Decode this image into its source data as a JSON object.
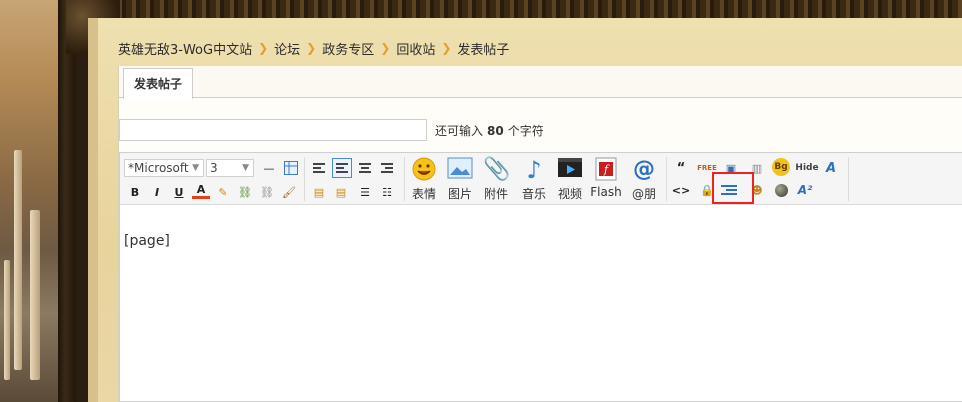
{
  "breadcrumb": {
    "items": [
      "英雄无敌3-WoG中文站",
      "论坛",
      "政务专区",
      "回收站",
      "发表帖子"
    ]
  },
  "tab": {
    "label": "发表帖子"
  },
  "subject": {
    "value": "",
    "remain_prefix": "还可输入",
    "remain_count": "80",
    "remain_suffix": "个字符"
  },
  "toolbar": {
    "font_select": "*Microsoft",
    "size_select": "3",
    "big_buttons": [
      "表情",
      "图片",
      "附件",
      "音乐",
      "视频",
      "Flash",
      "@朋"
    ],
    "bg_icon_text": "Bg",
    "hide_icon_text": "Hide",
    "quote_icon_text": "“",
    "code_icon_text": "<>",
    "free_icon_text": "FREE"
  },
  "editor": {
    "content": "[page]"
  },
  "colors": {
    "highlight": "#e22222",
    "breadcrumb_sep": "#e0a030"
  }
}
